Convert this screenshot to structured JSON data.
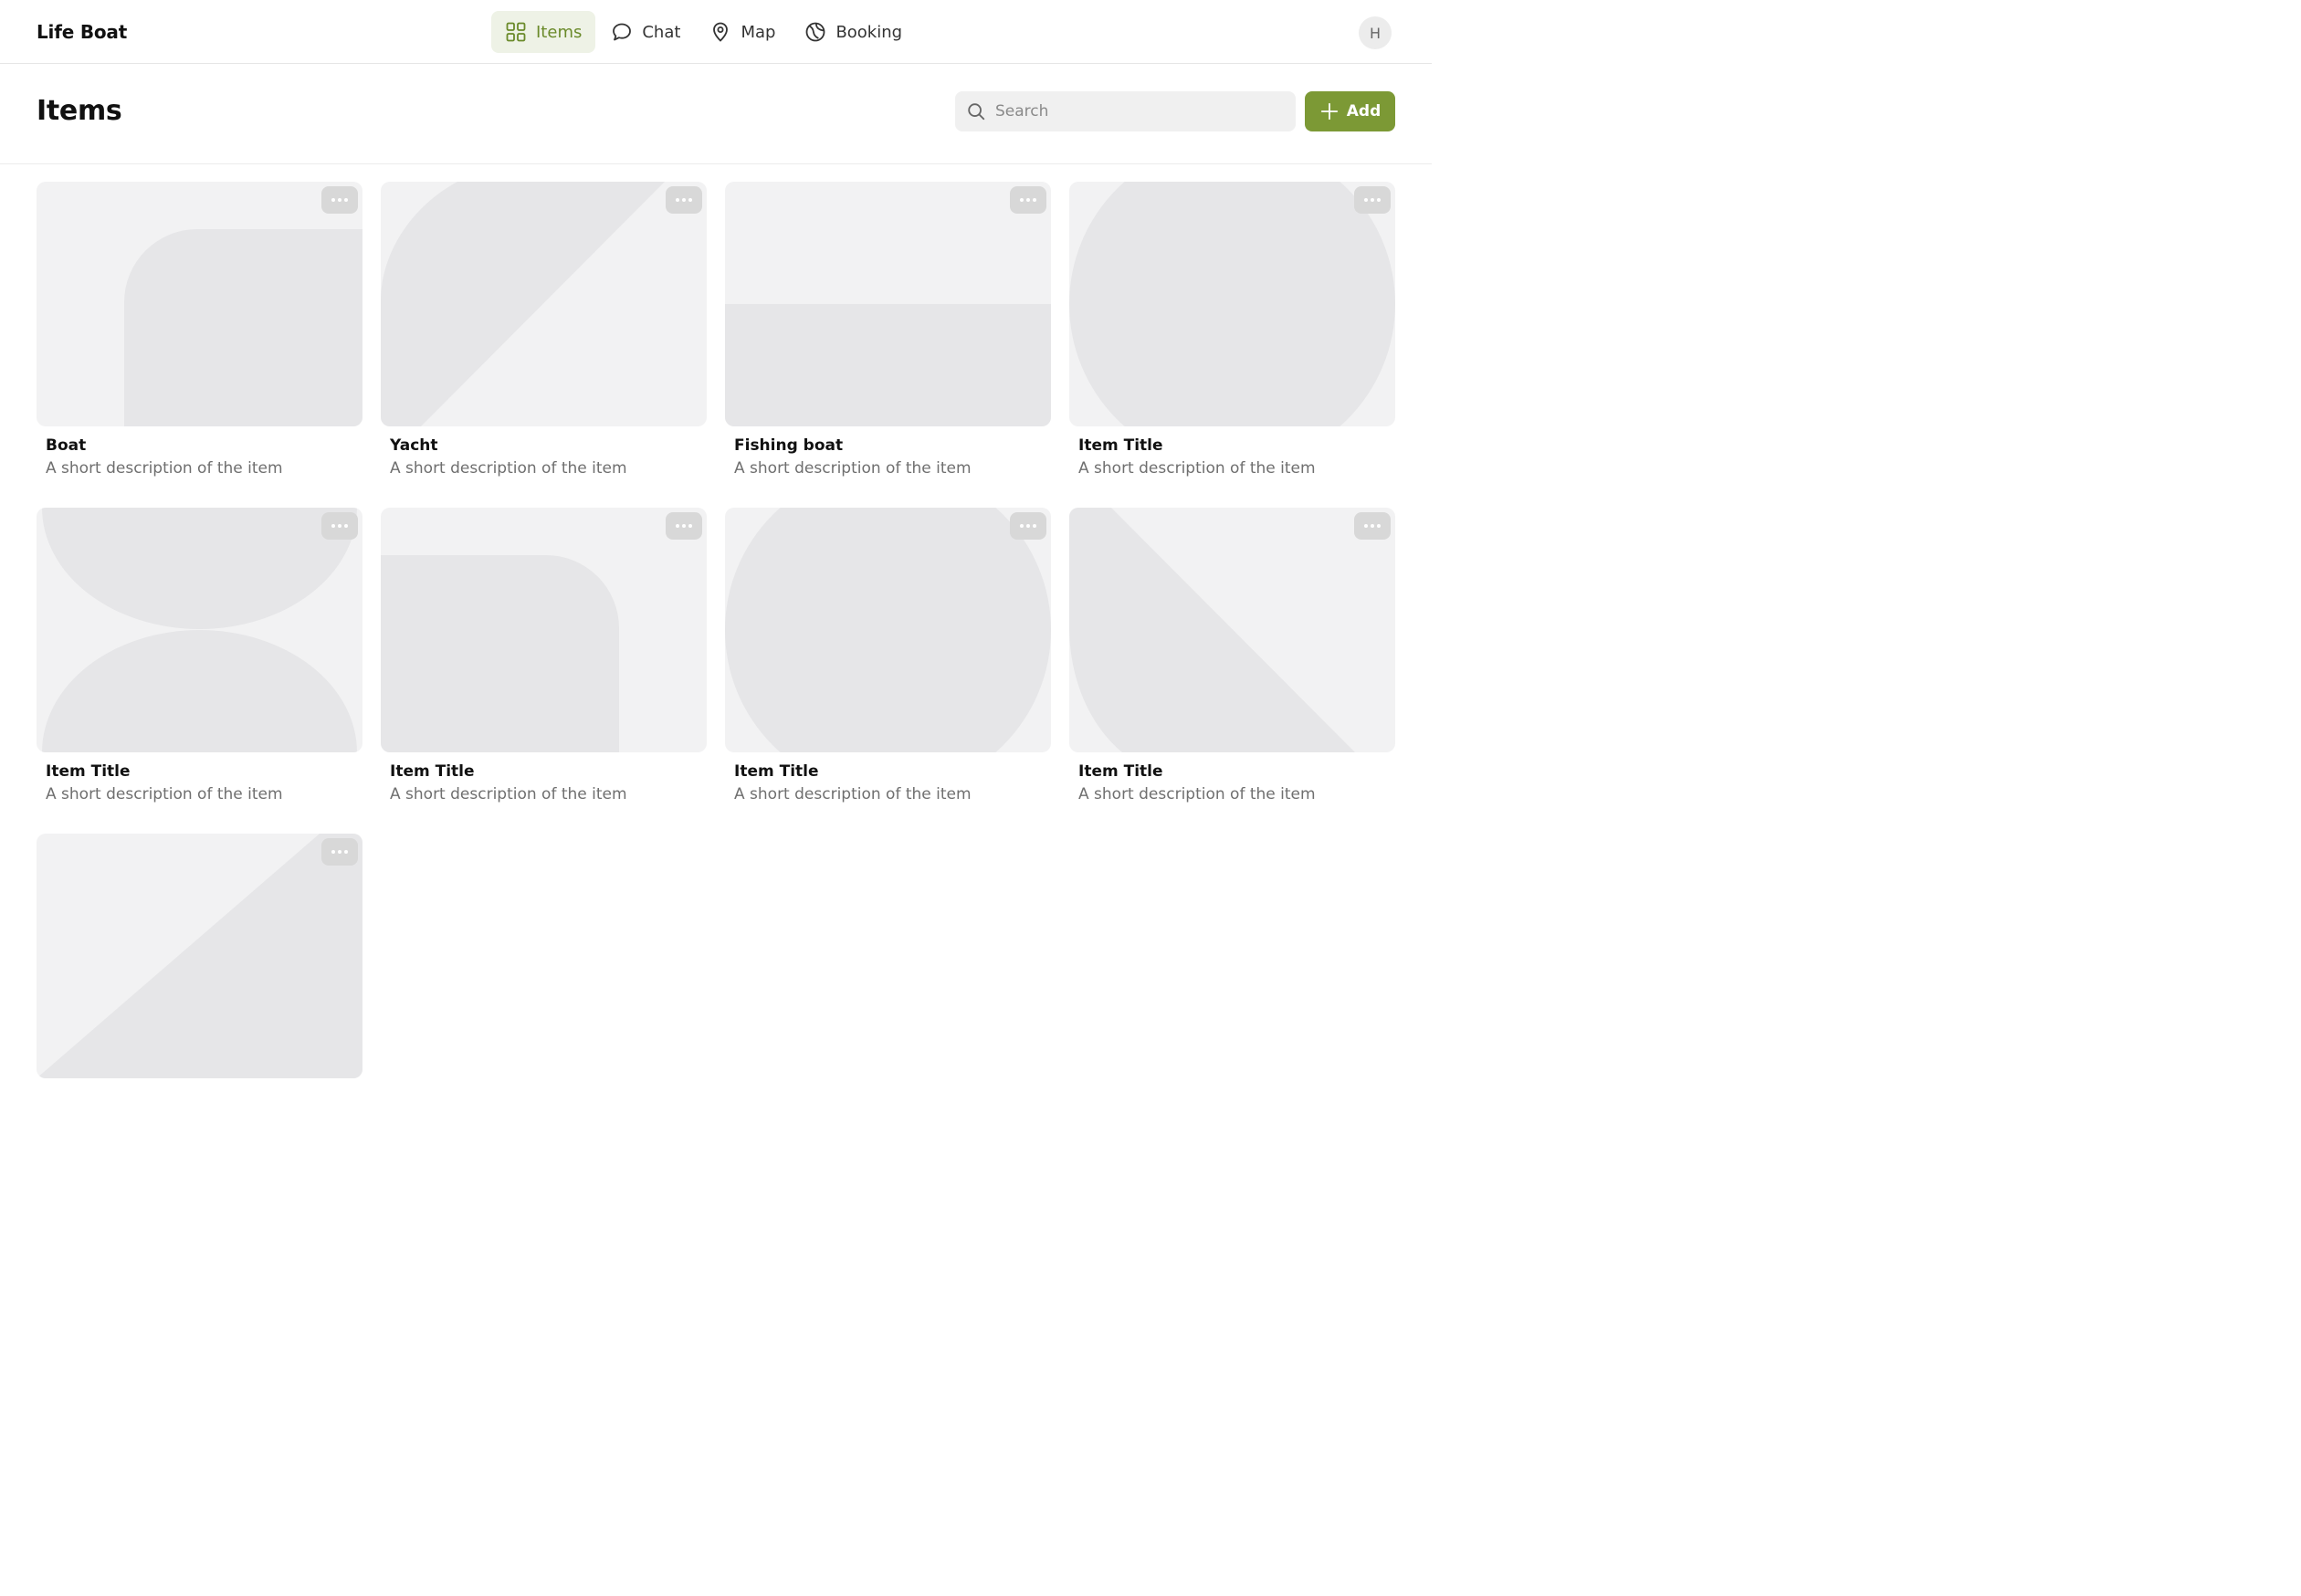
{
  "app": {
    "title": "Life Boat",
    "user_initial": "H"
  },
  "nav": {
    "items": [
      {
        "label": "Items",
        "icon": "grid-icon",
        "active": true
      },
      {
        "label": "Chat",
        "icon": "chat-bubble-icon",
        "active": false
      },
      {
        "label": "Map",
        "icon": "map-pin-icon",
        "active": false
      },
      {
        "label": "Booking",
        "icon": "globe-icon",
        "active": false
      }
    ]
  },
  "page": {
    "title": "Items",
    "search_placeholder": "Search",
    "search_value": "",
    "add_label": "Add"
  },
  "colors": {
    "accent": "#7c9935",
    "accent_text": "#6a8a2a",
    "accent_bg": "#eef2e6",
    "thumb_bg": "#f2f2f3",
    "thumb_shape": "#e6e6e8"
  },
  "cards": [
    {
      "title": "Boat",
      "description": "A short description of the item",
      "art": "rounded-corner"
    },
    {
      "title": "Yacht",
      "description": "A short description of the item",
      "art": "diagonal-arc"
    },
    {
      "title": "Fishing boat",
      "description": "A short description of the item",
      "art": "bottom-half"
    },
    {
      "title": "Item Title",
      "description": "A short description of the item",
      "art": "circle"
    },
    {
      "title": "Item Title",
      "description": "A short description of the item",
      "art": "hourglass"
    },
    {
      "title": "Item Title",
      "description": "A short description of the item",
      "art": "rounded-block"
    },
    {
      "title": "Item Title",
      "description": "A short description of the item",
      "art": "circle"
    },
    {
      "title": "Item Title",
      "description": "A short description of the item",
      "art": "left-diagonal"
    },
    {
      "title": "",
      "description": "",
      "art": "bottom-triangle"
    }
  ]
}
